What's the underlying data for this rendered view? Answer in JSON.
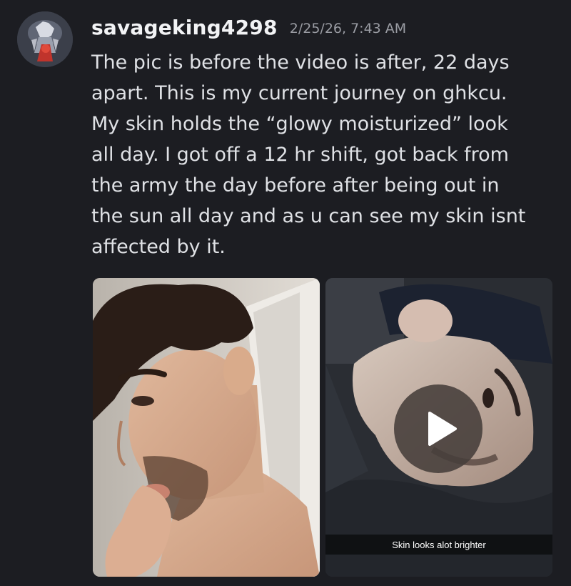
{
  "message": {
    "username": "savageking4298",
    "timestamp": "2/25/26, 7:43 AM",
    "body": "The pic is before the video is after, 22 days\napart. This is my current journey on ghkcu.\nMy skin holds the “glowy moisturized” look\nall day. I got off a 12 hr shift, got back from\nthe army the day before after being out in\nthe sun all day and as u can see my skin isnt\naffected by it."
  },
  "attachments": {
    "video_caption": "Skin looks alot brighter"
  },
  "colors": {
    "background": "#1c1d22",
    "username": "#f2f3f5",
    "timestamp": "#9a9ca3",
    "text": "#dfe1e5"
  },
  "icons": {
    "play": "play-icon"
  }
}
